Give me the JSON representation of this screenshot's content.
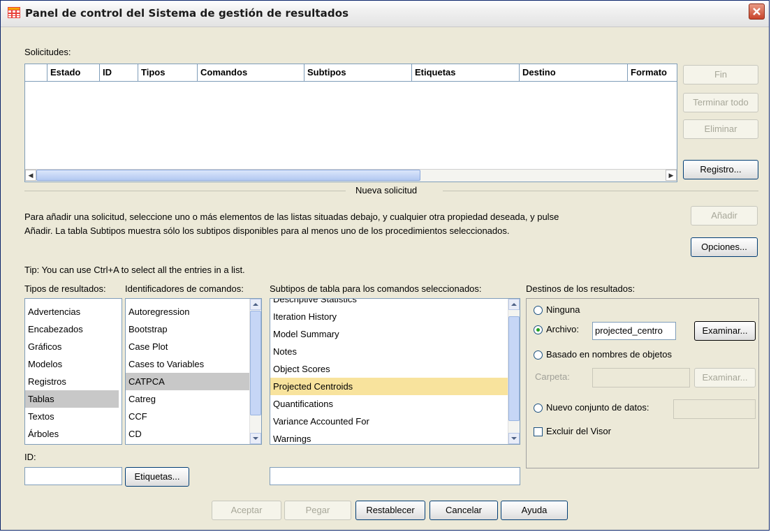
{
  "window": {
    "title": "Panel de control del Sistema de gestión de resultados"
  },
  "requests": {
    "label": "Solicitudes:",
    "columns": [
      "",
      "Estado",
      "ID",
      "Tipos",
      "Comandos",
      "Subtipos",
      "Etiquetas",
      "Destino",
      "Formato"
    ]
  },
  "side_buttons": {
    "fin": "Fin",
    "terminar": "Terminar todo",
    "eliminar": "Eliminar",
    "registro": "Registro..."
  },
  "new_request": {
    "heading": "Nueva solicitud",
    "line1": "Para añadir una solicitud, seleccione uno o más elementos de las listas situadas debajo, y cualquier otra propiedad deseada, y pulse",
    "line2": "Añadir. La tabla Subtipos muestra sólo los subtipos disponibles para al menos uno de los procedimientos seleccionados.",
    "add": "Añadir",
    "options": "Opciones...",
    "tip": "Tip: You can use Ctrl+A to select all the entries in a list."
  },
  "output_types": {
    "label": "Tipos de resultados:",
    "items": [
      "Advertencias",
      "Encabezados",
      "Gráficos",
      "Modelos",
      "Registros",
      "Tablas",
      "Textos",
      "Árboles"
    ],
    "selected": "Tablas"
  },
  "command_ids": {
    "label": "Identificadores de comandos:",
    "items": [
      "Autoregression",
      "Bootstrap",
      "Case Plot",
      "Cases to Variables",
      "CATPCA",
      "Catreg",
      "CCF",
      "CD"
    ],
    "selected": "CATPCA"
  },
  "subtypes": {
    "label": "Subtipos de tabla para los comandos seleccionados:",
    "items": [
      "Descriptive Statistics",
      "Iteration History",
      "Model Summary",
      "Notes",
      "Object Scores",
      "Projected Centroids",
      "Quantifications",
      "Variance Accounted For",
      "Warnings"
    ],
    "selected": "Projected Centroids"
  },
  "id_label": "ID:",
  "labels_button": "Etiquetas...",
  "destinations": {
    "label": "Destinos de los resultados:",
    "none": "Ninguna",
    "file": "Archivo:",
    "file_value": "projected_centro",
    "browse": "Examinar...",
    "object_names": "Basado en nombres de objetos",
    "folder": "Carpeta:",
    "browse2": "Examinar...",
    "new_dataset": "Nuevo conjunto de datos:",
    "exclude": "Excluir del Visor"
  },
  "bottom": {
    "ok": "Aceptar",
    "paste": "Pegar",
    "reset": "Restablecer",
    "cancel": "Cancelar",
    "help": "Ayuda"
  }
}
